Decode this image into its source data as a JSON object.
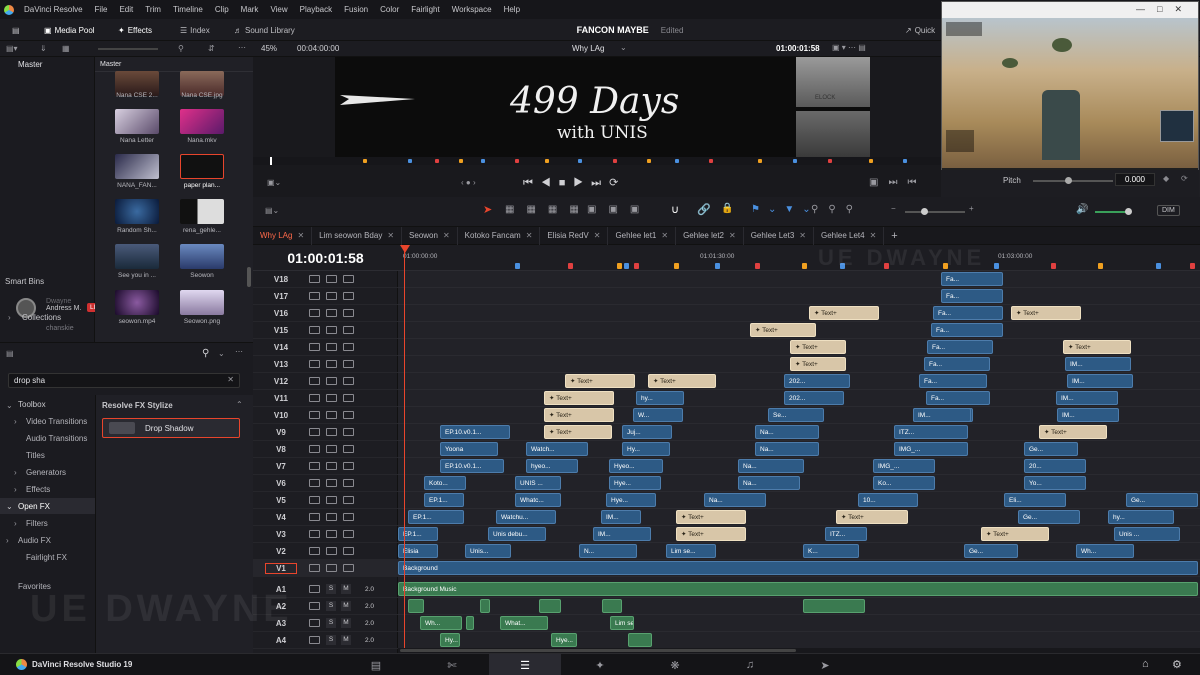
{
  "menubar": {
    "app_name": "DaVinci Resolve",
    "items": [
      "File",
      "Edit",
      "Trim",
      "Timeline",
      "Clip",
      "Mark",
      "View",
      "Playback",
      "Fusion",
      "Color",
      "Fairlight",
      "Workspace",
      "Help"
    ]
  },
  "toolbar": {
    "media_pool": "Media Pool",
    "effects": "Effects",
    "index": "Index",
    "sound_library": "Sound Library",
    "project_title": "FANCON MAYBE",
    "project_status": "Edited",
    "quick_export": "Quick"
  },
  "viewer": {
    "zoom": "45%",
    "source_timecode": "00:04:00:00",
    "timeline_name": "Why LAg",
    "record_timecode": "01:00:01:58",
    "title_main": "499 Days",
    "title_sub": "with UNIS",
    "side_text": "ELOCK"
  },
  "inspector": {
    "param_label": "Pitch",
    "param_value": "0.000"
  },
  "media_pool": {
    "bin_header": "Master",
    "sidebar_header": "Master",
    "clips": [
      {
        "name": "Nana CSE 2..."
      },
      {
        "name": "Nana CSE.jpg"
      },
      {
        "name": "Nana Letter"
      },
      {
        "name": "Nana.mkv"
      },
      {
        "name": "NANA_FAN..."
      },
      {
        "name": "paper plan..."
      },
      {
        "name": "Random Sh..."
      },
      {
        "name": "rena_gehle..."
      },
      {
        "name": "See you in ..."
      },
      {
        "name": "Seowon"
      },
      {
        "name": "seowon.mp4"
      },
      {
        "name": "Seowon.png"
      }
    ],
    "collaborators": [
      {
        "name": "Andress M.",
        "badge": "LIVE"
      },
      {
        "name": "chanskie"
      },
      {
        "name": "Dwayne"
      }
    ],
    "smart_bins": "Smart Bins",
    "collections": "Collections"
  },
  "effects": {
    "search_value": "drop sha",
    "categories": [
      {
        "label": "Toolbox",
        "level": 0
      },
      {
        "label": "Video Transitions",
        "level": 1
      },
      {
        "label": "Audio Transitions",
        "level": 1
      },
      {
        "label": "Titles",
        "level": 1
      },
      {
        "label": "Generators",
        "level": 1
      },
      {
        "label": "Effects",
        "level": 1
      },
      {
        "label": "Open FX",
        "level": 0
      },
      {
        "label": "Filters",
        "level": 1
      },
      {
        "label": "Audio FX",
        "level": 0
      },
      {
        "label": "Fairlight FX",
        "level": 1
      },
      {
        "label": "Favorites",
        "level": 0
      }
    ],
    "group_title": "Resolve FX Stylize",
    "result": "Drop Shadow"
  },
  "timeline": {
    "tabs": [
      "Why LAg",
      "Lim seowon Bday",
      "Seowon",
      "Kotoko Fancam",
      "Elisia RedV",
      "Gehlee let1",
      "Gehlee let2",
      "Gehlee Let3",
      "Gehlee Let4"
    ],
    "timecode": "01:00:01:58",
    "ruler": [
      "01:00:00:00",
      "01:01:30:00",
      "01:03:00:00"
    ],
    "watermark": "UE DWAYNE",
    "dim_label": "DIM",
    "video_tracks": [
      "V18",
      "V17",
      "V16",
      "V15",
      "V14",
      "V13",
      "V12",
      "V11",
      "V10",
      "V9",
      "V8",
      "V7",
      "V6",
      "V5",
      "V4",
      "V3",
      "V2",
      "V1"
    ],
    "audio_tracks": [
      {
        "name": "A1",
        "level": "2.0"
      },
      {
        "name": "A2",
        "level": "2.0"
      },
      {
        "name": "A3",
        "level": "2.0"
      },
      {
        "name": "A4",
        "level": "2.0"
      }
    ],
    "clips": {
      "bg": "Background",
      "bgm": "Background Music",
      "texts": [
        "Text+",
        "Text+",
        "Text+",
        "Text+",
        "Text+",
        "Text+",
        "Text+",
        "Text+",
        "Text+",
        "Text+",
        "Text+",
        "Text+",
        "Text+",
        "Text+",
        "Text+"
      ],
      "labels": [
        "Fa...",
        "Fa...",
        "Fa...",
        "Fa...",
        "Fa...",
        "Fa...",
        "Fa...",
        "Fa...",
        "Fa...",
        "202...",
        "202...",
        "Se...",
        "Na...",
        "Na...",
        "Na...",
        "Na...",
        "Na...",
        "EP.10.v0.1...",
        "Yoona",
        "EP.10.v0.1...",
        "Koto...",
        "EP.1...",
        "EP.1...",
        "EP.1...",
        "Elisia",
        "Unis debu...",
        "Unis...",
        "Watchu...",
        "Whatc...",
        "Watch...",
        "W...",
        "UNIS ...",
        "hyeo...",
        "hy...",
        "Juj...",
        "Hy...",
        "Hyeo...",
        "Hye...",
        "Hye...",
        "IM...",
        "IM...",
        "N...",
        "Lim se...",
        "K...",
        "ITZ...",
        "ITZ...",
        "IMG_...",
        "IMG_...",
        "Ko...",
        "10...",
        "IM...",
        "IM...",
        "IM...",
        "IM...",
        "IM...",
        "20...",
        "Yo...",
        "Eli...",
        "Ge...",
        "Ge...",
        "Ge...",
        "Ge...",
        "hy...",
        "Unis ...",
        "Wh...",
        "What...",
        "Hy...",
        "Hye...",
        "Hyeo...",
        "Lim se..."
      ]
    }
  },
  "pages": [
    "media",
    "cut",
    "edit",
    "fusion",
    "color",
    "fairlight",
    "deliver"
  ],
  "footer": {
    "app_label": "DaVinci Resolve Studio 19"
  },
  "colors": {
    "accent": "#ff6a4a",
    "video_clip": "#2d5a85",
    "text_clip": "#d8c6a8",
    "audio_clip": "#3a7a50",
    "playhead": "#e8452c"
  }
}
